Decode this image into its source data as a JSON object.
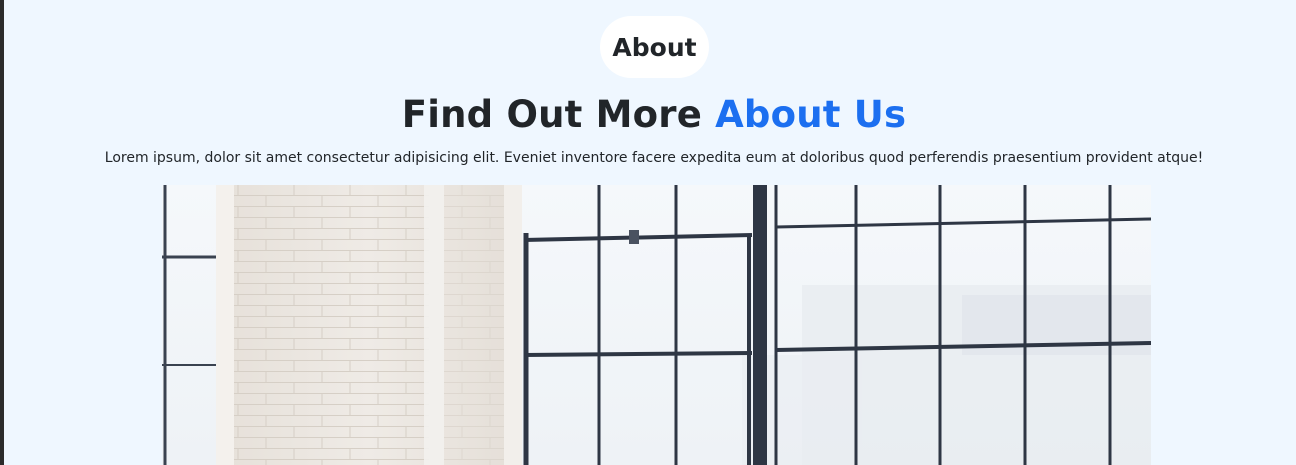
{
  "about_badge": "About",
  "heading": {
    "main": "Find Out More ",
    "accent": "About Us"
  },
  "description": "Lorem ipsum, dolor sit amet consectetur adipisicing elit. Eveniet inventore facere expedita eum at doloribus quod perferendis praesentium provident atque!",
  "colors": {
    "background": "#eff7ff",
    "accent": "#1c6ff0",
    "text": "#212529"
  }
}
